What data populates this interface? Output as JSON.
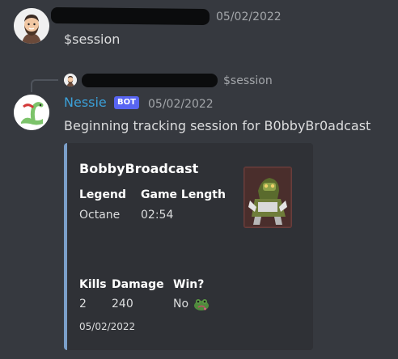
{
  "message1": {
    "timestamp": "05/02/2022",
    "content": "$session"
  },
  "reply": {
    "content": "$session"
  },
  "message2": {
    "author": "Nessie",
    "badge": "BOT",
    "timestamp": "05/02/2022",
    "content": "Beginning tracking session for B0bbyBr0adcast",
    "author_color": "#3ba0d8"
  },
  "embed": {
    "title": "BobbyBroadcast",
    "fields_top": [
      {
        "name": "Legend",
        "value": "Octane"
      },
      {
        "name": "Game Length",
        "value": "02:54"
      }
    ],
    "fields_bottom": [
      {
        "name": "Kills",
        "value": "2"
      },
      {
        "name": "Damage",
        "value": "240"
      },
      {
        "name": "Win?",
        "value": "No"
      }
    ],
    "footer": "05/02/2022",
    "thumbnail_icon": "octane-legend-icon",
    "win_emoji_icon": "frog-emoji-icon"
  }
}
